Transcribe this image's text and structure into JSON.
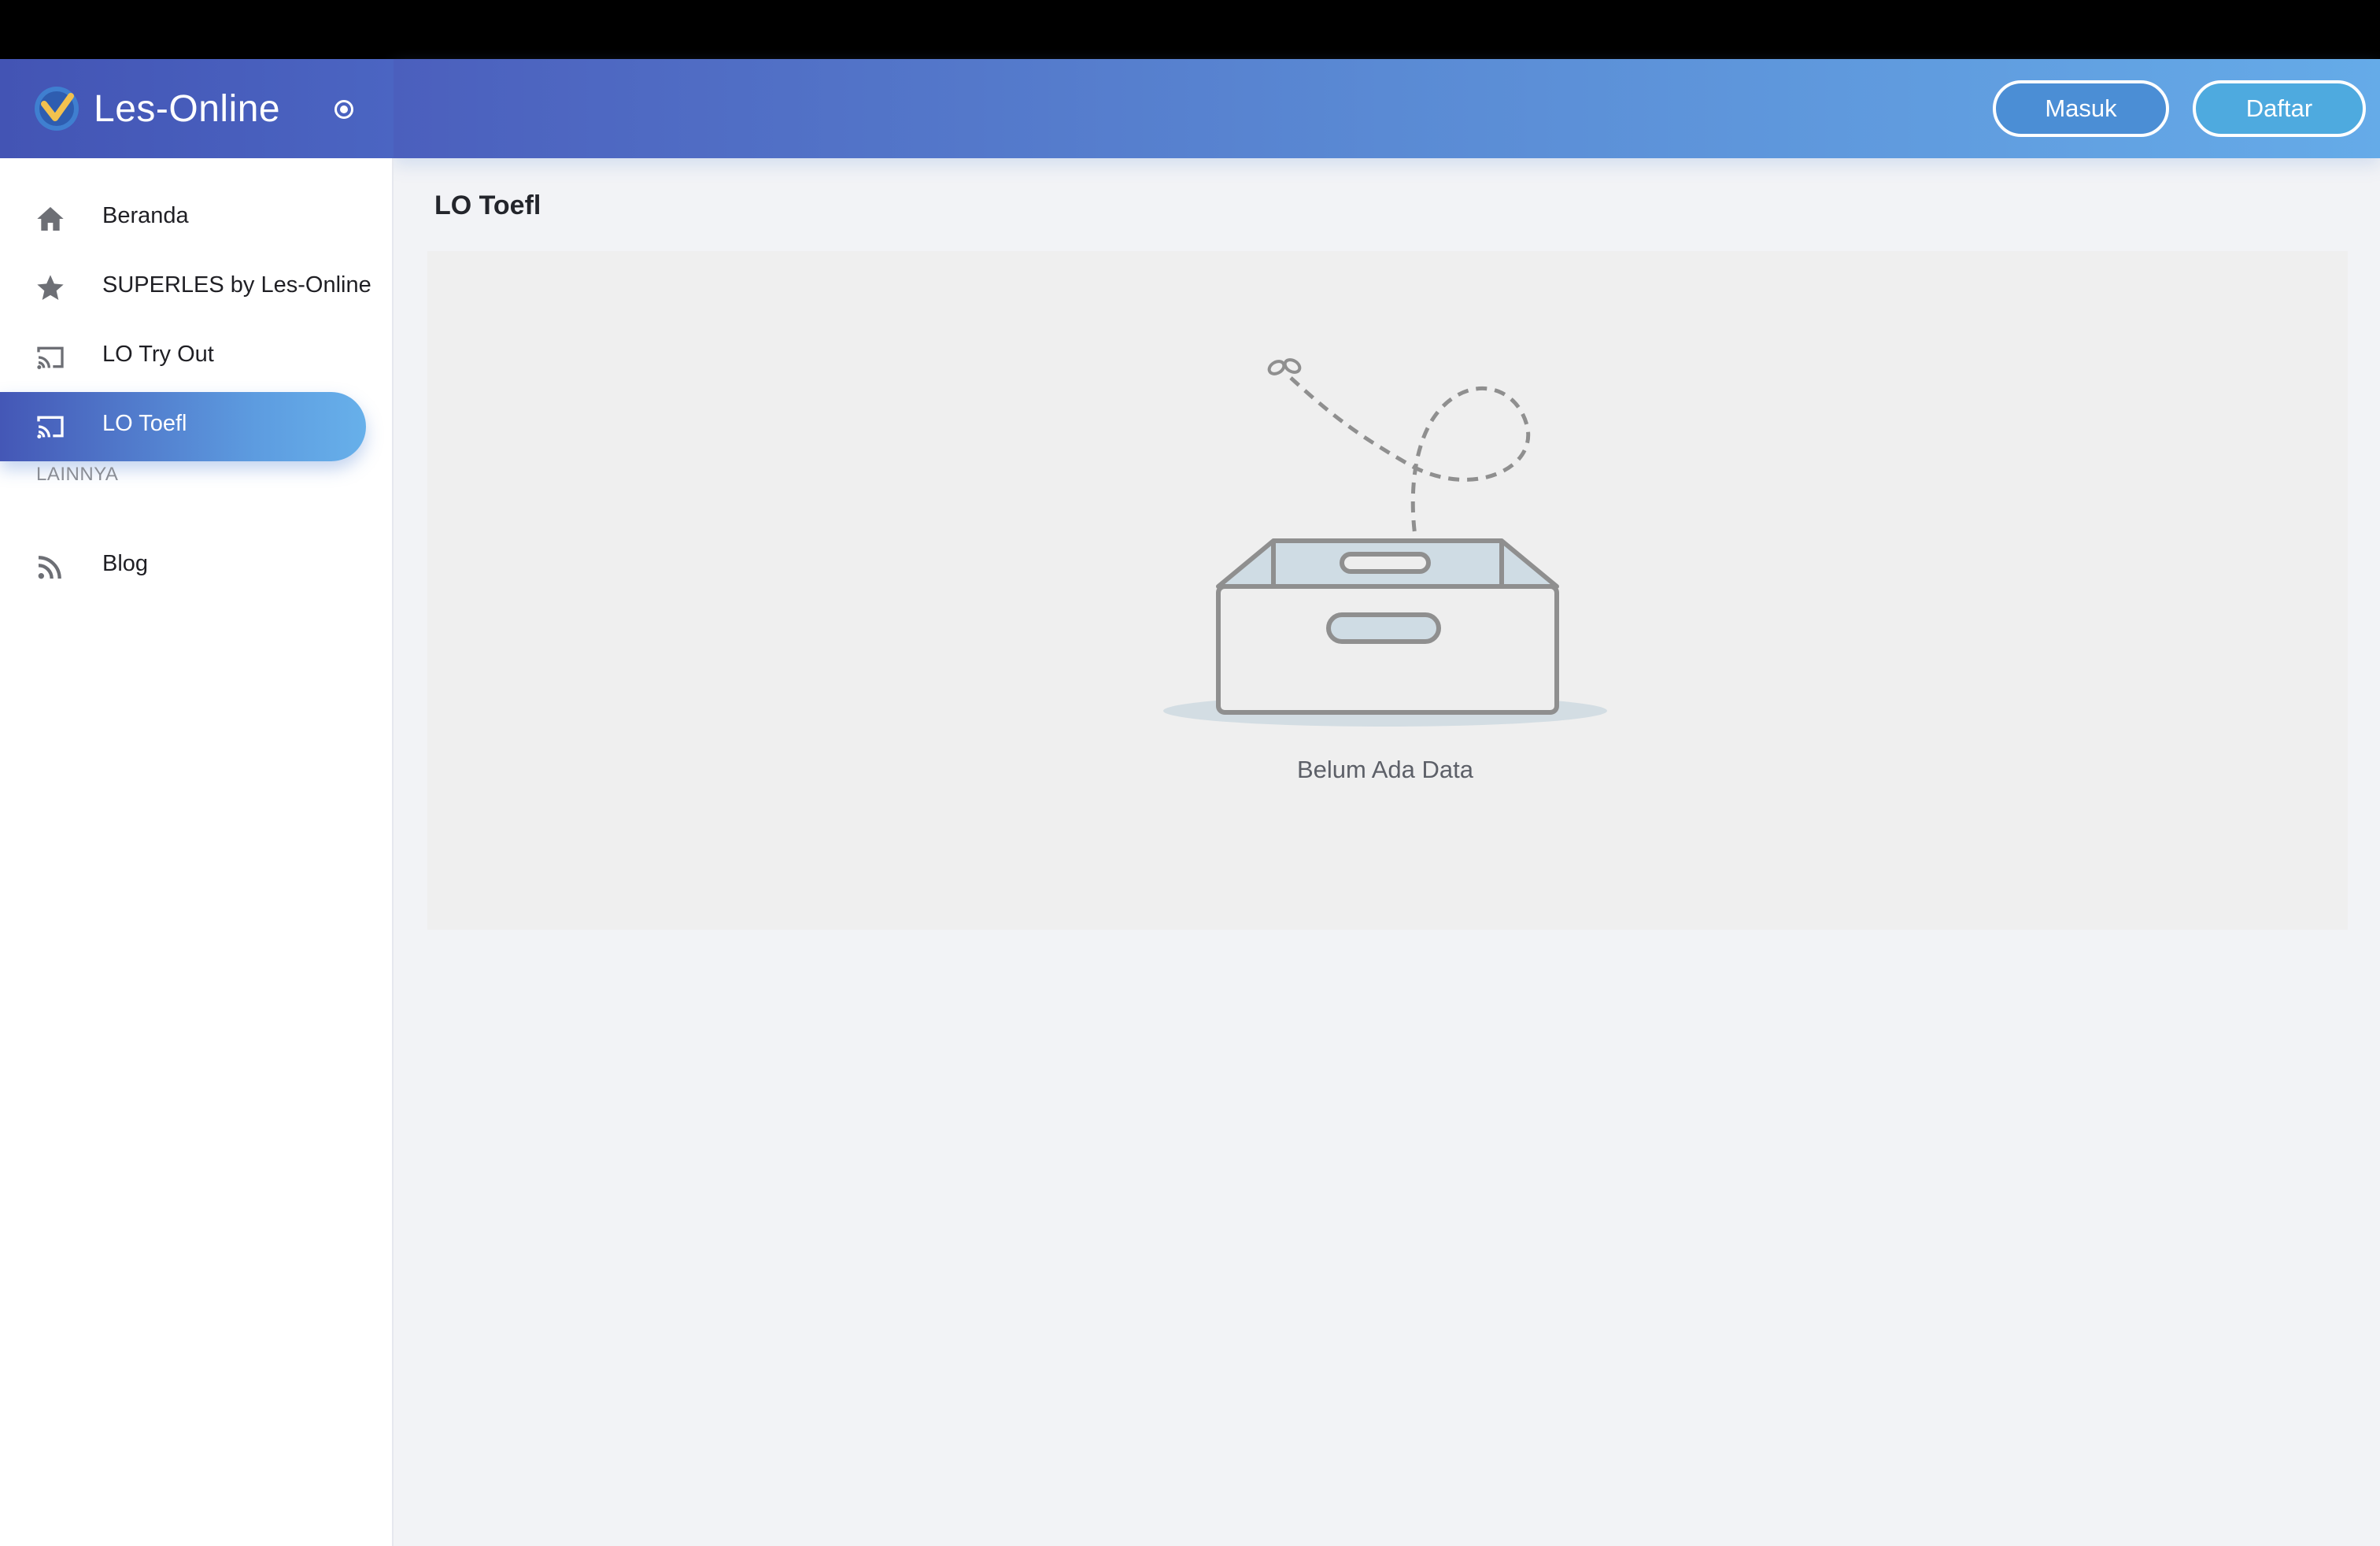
{
  "brand": {
    "name": "Les-Online",
    "logo_icon": "les-online-logo-icon"
  },
  "sidebar": {
    "items": [
      {
        "label": "Beranda",
        "icon": "home-icon",
        "active": false
      },
      {
        "label": "SUPERLES by Les-Online",
        "icon": "star-icon",
        "active": false
      },
      {
        "label": "LO Try Out",
        "icon": "cast-icon",
        "active": false
      },
      {
        "label": "LO Toefl",
        "icon": "cast-icon",
        "active": true
      }
    ],
    "section_label": "LAINNYA",
    "other_items": [
      {
        "label": "Blog",
        "icon": "rss-icon"
      }
    ]
  },
  "header": {
    "login_label": "Masuk",
    "register_label": "Daftar"
  },
  "main": {
    "title": "LO Toefl",
    "empty_state": "Belum Ada Data"
  },
  "colors": {
    "brand_gradient_start": "#4354b4",
    "brand_gradient_end": "#65abe8",
    "active_item": "#5d9ce0",
    "panel_bg": "#efefef"
  }
}
